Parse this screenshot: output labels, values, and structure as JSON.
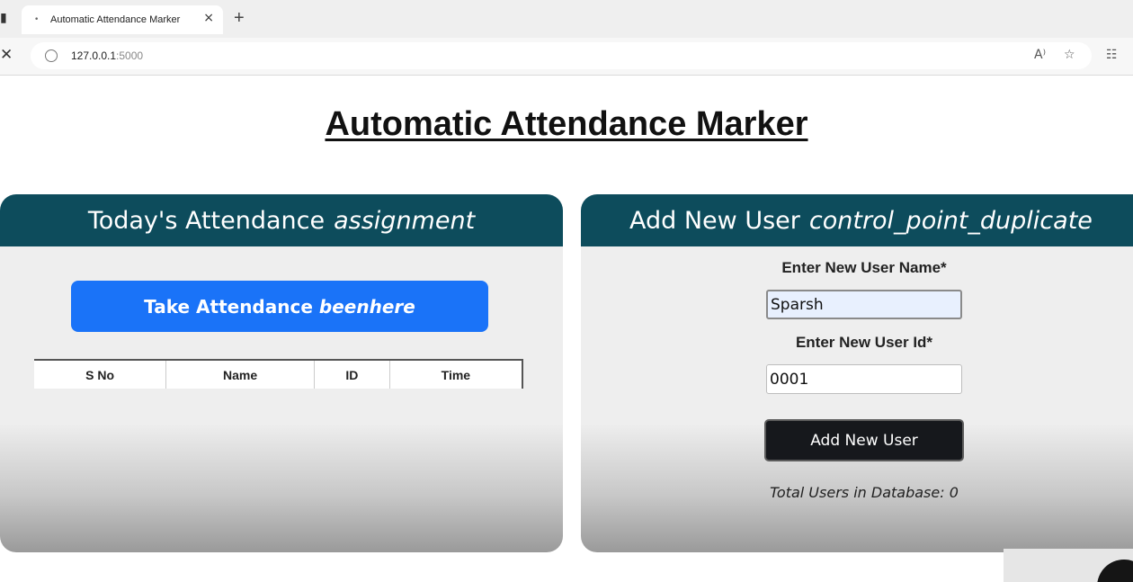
{
  "browser": {
    "tab": {
      "title": "Automatic Attendance Marker"
    },
    "url": {
      "host": "127.0.0.1",
      "port": ":5000"
    }
  },
  "page": {
    "title": "Automatic Attendance Marker"
  },
  "attendance": {
    "header_title": "Today's Attendance",
    "header_icon": "assignment",
    "take_label": "Take Attendance",
    "take_icon": "beenhere",
    "columns": [
      "S No",
      "Name",
      "ID",
      "Time"
    ]
  },
  "add_user": {
    "header_title": "Add New User",
    "header_icon": "control_point_duplicate",
    "name_label": "Enter New User Name*",
    "name_value": "Sparsh",
    "id_label": "Enter New User Id*",
    "id_value": "0001",
    "button_label": "Add New User",
    "total_label": "Total Users in Database: 0"
  },
  "colors": {
    "header": "#0d4c5c",
    "primary_button": "#1a73f8",
    "dark_button": "#16181c"
  }
}
